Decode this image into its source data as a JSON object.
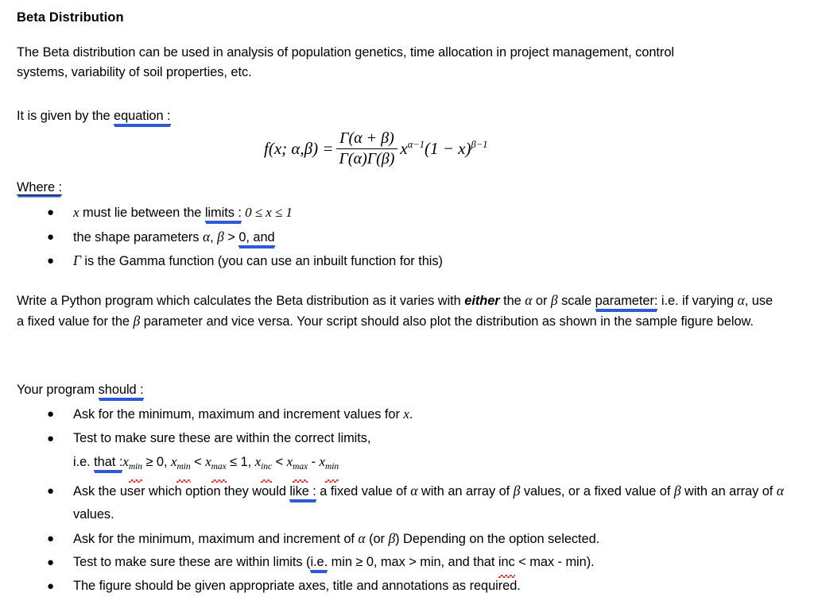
{
  "document": {
    "title": "Beta Distribution",
    "intro": "The Beta distribution can be used in analysis of population genetics, time allocation in project management, control systems, variability of soil properties, etc.",
    "given_by_prefix": "It is given by the ",
    "given_by_marked": "equation :",
    "where_label": "Where :",
    "where_bullets": [
      {
        "pre": "x",
        "mid": " must lie between the ",
        "marked": "limits :",
        "post": " 0 ≤ x ≤ 1"
      },
      {
        "pre": "the shape parameters ",
        "alpha": "α",
        "comma": ", ",
        "beta": "β",
        "gt": " > ",
        "marked": "0,  and"
      },
      {
        "gamma": "Γ",
        "text": " is the Gamma function (you can use an inbuilt function for this)"
      }
    ],
    "write_paragraph": {
      "part1": "Write a Python program which calculates the Beta distribution as it varies with ",
      "either": "either",
      "part2": " the ",
      "alpha": "α",
      "part3": " or ",
      "beta": "β",
      "part4": " scale ",
      "marked": "parameter:",
      "part5": " i.e. if varying ",
      "alpha2": "α",
      "part6": ", use a fixed value for the ",
      "beta2": "β",
      "part7": " parameter and vice versa. Your script should also plot the distribution as shown in the sample figure below."
    },
    "should_prefix": "Your program ",
    "should_marked": "should :",
    "program_bullets": [
      {
        "id": "ask-x-range",
        "text_pre": "Ask for the minimum, maximum and increment values for ",
        "var": "x",
        "text_post": "."
      },
      {
        "id": "test-limits",
        "text_pre": "Test to make sure these are within the correct limits,",
        "var": "",
        "text_post": ""
      },
      {
        "id": "ask-option",
        "text_pre": "Ask the user which option they would ",
        "marked": "like :",
        "mid": " a fixed value of ",
        "alpha": "α",
        "mid2": " with an array of ",
        "beta": "β",
        "mid3": " values, or a fixed value of ",
        "beta2": "β",
        "mid4": " with an array of ",
        "alpha2": "α",
        "text_post": " values."
      },
      {
        "id": "ask-param-range",
        "text_pre": "Ask for the minimum, maximum and increment of ",
        "alpha": "α",
        "mid": " (or ",
        "beta": "β",
        "text_post": ") Depending on the option selected."
      },
      {
        "id": "test-param-limits",
        "text_pre": "Test to make sure these are within limits (",
        "marked": "i.e.",
        "mid": " min ≥ 0, max > min, and that ",
        "squiggled": "inc",
        "text_post": " < max - min)."
      },
      {
        "id": "figure-annotations",
        "text_pre": "The figure should be given appropriate axes, title and annotations as required.",
        "text_post": ""
      }
    ],
    "limits_line": {
      "prefix": "i.e. ",
      "marked": "that :",
      "x1": "x",
      "sub1": "min",
      "op1": " ≥ 0,  ",
      "x2": "x",
      "sub2": "min",
      "op2": " < ",
      "x3": "x",
      "sub3": "max",
      "op3": " ≤ 1,  ",
      "x4": "x",
      "sub4": "inc",
      "op4": " < ",
      "x5": "x",
      "sub5": "max",
      "op5": " - ",
      "x6": "x",
      "sub6": "min"
    },
    "equation": {
      "lhs": "f(x; α,β) =",
      "numerator": "Γ(α + β)",
      "denominator": "Γ(α)Γ(β)",
      "tail_base": "x",
      "tail_exp1": "α−1",
      "tail_mid": "(1 − x)",
      "tail_exp2": "β−1"
    },
    "colors": {
      "grammar_underline": "#2b5bd7",
      "spelling_squiggle": "#e8241c",
      "text": "#000000",
      "background": "#ffffff"
    }
  }
}
